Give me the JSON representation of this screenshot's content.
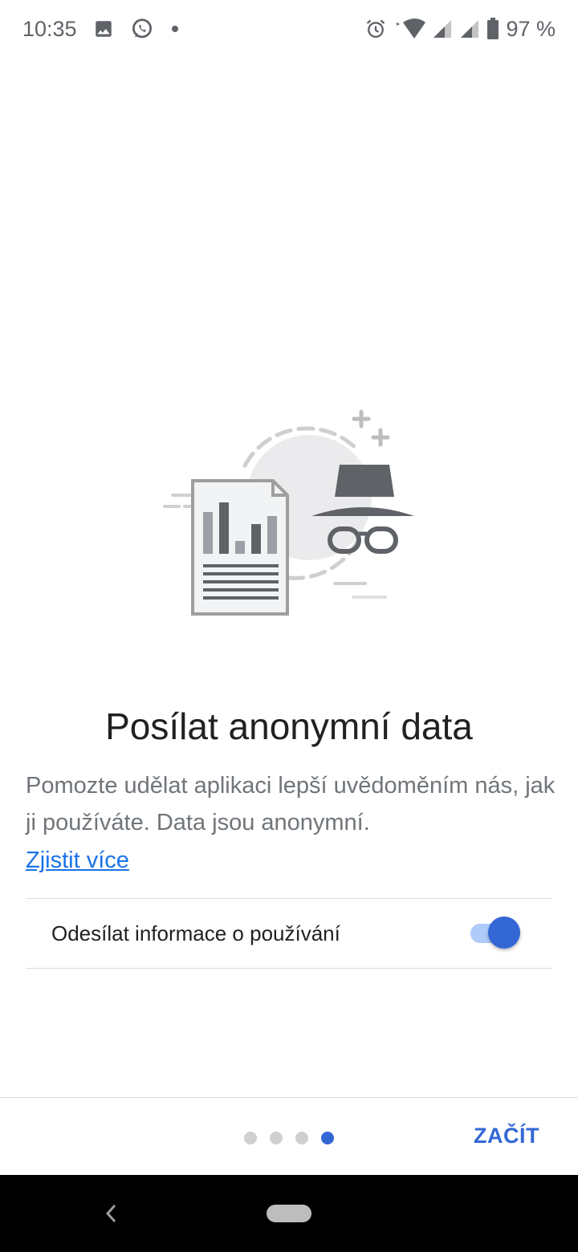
{
  "status_bar": {
    "time": "10:35",
    "battery_text": "97 %",
    "icons": [
      "image-icon",
      "whatsapp-icon",
      "dot-icon",
      "alarm-icon",
      "wifi-icon",
      "signal-icon",
      "signal-icon",
      "battery-icon"
    ]
  },
  "illustration": {
    "name": "anonymous-data-illustration",
    "icons": [
      "document-chart-icon",
      "incognito-icon"
    ]
  },
  "onboarding": {
    "title": "Posílat anonymní data",
    "description": "Pomozte udělat aplikaci lepší uvědoměním nás, jak ji používáte. Data jsou anonymní.",
    "learn_more": "Zjistit více"
  },
  "preference": {
    "label": "Odesílat informace o používání",
    "enabled": true
  },
  "pager": {
    "total_pages": 4,
    "current_page": 4
  },
  "footer": {
    "start_label": "ZAČÍT"
  },
  "colors": {
    "accent": "#3367d6",
    "link": "#1a73e8",
    "toggle_track": "#aecbfa",
    "inactive_dot": "#d0d0d0",
    "nav_bar": "#000000"
  }
}
